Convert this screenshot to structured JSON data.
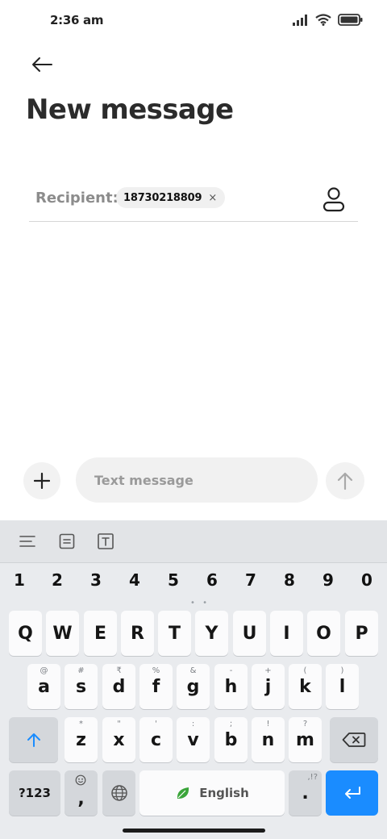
{
  "status_bar": {
    "time": "2:36 am"
  },
  "header": {
    "title": "New message"
  },
  "recipient": {
    "label": "Recipient:",
    "chip_number": "18730218809",
    "chip_remove": "×"
  },
  "composer": {
    "placeholder": "Text message",
    "value": ""
  },
  "keyboard": {
    "numbers": [
      "1",
      "2",
      "3",
      "4",
      "5",
      "6",
      "7",
      "8",
      "9",
      "0"
    ],
    "row1": [
      "Q",
      "W",
      "E",
      "R",
      "T",
      "Y",
      "U",
      "I",
      "O",
      "P"
    ],
    "row2": [
      {
        "key": "a",
        "sub": "@"
      },
      {
        "key": "s",
        "sub": "#"
      },
      {
        "key": "d",
        "sub": "₹"
      },
      {
        "key": "f",
        "sub": "%"
      },
      {
        "key": "g",
        "sub": "&"
      },
      {
        "key": "h",
        "sub": "-"
      },
      {
        "key": "j",
        "sub": "+"
      },
      {
        "key": "k",
        "sub": "("
      },
      {
        "key": "l",
        "sub": ")"
      }
    ],
    "row3": [
      {
        "key": "z",
        "sub": "*"
      },
      {
        "key": "x",
        "sub": "\""
      },
      {
        "key": "c",
        "sub": "'"
      },
      {
        "key": "v",
        "sub": ":"
      },
      {
        "key": "b",
        "sub": ";"
      },
      {
        "key": "n",
        "sub": "!"
      },
      {
        "key": "m",
        "sub": "?"
      }
    ],
    "symbols_label": "?123",
    "comma": ",",
    "space_label": "English",
    "period": ".",
    "period_sub": ",!?"
  },
  "colors": {
    "enter_key": "#1a8cff",
    "shift_arrow": "#1a8cff",
    "leaf": "#3aa53a"
  }
}
